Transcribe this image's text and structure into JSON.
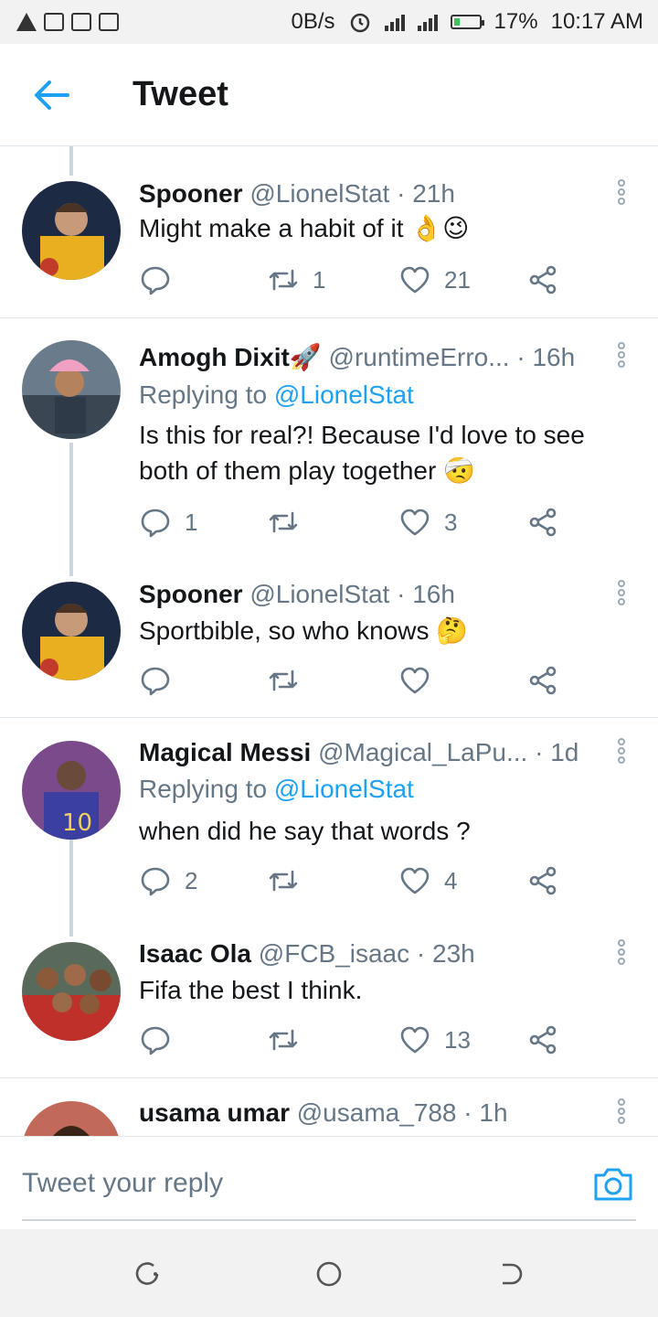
{
  "status_bar": {
    "net_speed": "0B/s",
    "battery_percent": "17%",
    "time": "10:17 AM"
  },
  "header": {
    "title": "Tweet"
  },
  "tweets": [
    {
      "name": "Spooner",
      "handle": "@LionelStat",
      "age": "· 21h",
      "text": "Might make a habit of it 👌😉",
      "replies": "",
      "retweets": "1",
      "likes": "21"
    },
    {
      "name": "Amogh Dixit🚀",
      "handle": "@runtimeErro...",
      "age": "· 16h",
      "replying_prefix": "Replying to",
      "replying_to": "@LionelStat",
      "text": "Is this for real?! Because I'd love to see both of them play together 🤕",
      "replies": "1",
      "retweets": "",
      "likes": "3"
    },
    {
      "name": "Spooner",
      "handle": "@LionelStat",
      "age": "· 16h",
      "text": "Sportbible, so who knows 🤔",
      "replies": "",
      "retweets": "",
      "likes": ""
    },
    {
      "name": "Magical Messi",
      "handle": "@Magical_LaPu...",
      "age": "· 1d",
      "replying_prefix": "Replying to",
      "replying_to": "@LionelStat",
      "text": "when did he say that words ?",
      "replies": "2",
      "retweets": "",
      "likes": "4"
    },
    {
      "name": "Isaac Ola",
      "handle": "@FCB_isaac",
      "age": "· 23h",
      "text": "Fifa the best I think.",
      "replies": "",
      "retweets": "",
      "likes": "13"
    },
    {
      "name": "usama umar",
      "handle": "@usama_788",
      "age": "· 1h",
      "text": "",
      "replies": "",
      "retweets": "",
      "likes": ""
    }
  ],
  "reply_bar": {
    "placeholder": "Tweet your reply"
  },
  "icons": {
    "back": "back-arrow-icon",
    "more": "more-vertical-icon",
    "reply": "reply-icon",
    "retweet": "retweet-icon",
    "like": "heart-icon",
    "share": "share-icon",
    "camera": "camera-icon"
  },
  "colors": {
    "accent": "#1da1f2",
    "secondary_text": "#657786",
    "divider": "#e1e8ed"
  }
}
